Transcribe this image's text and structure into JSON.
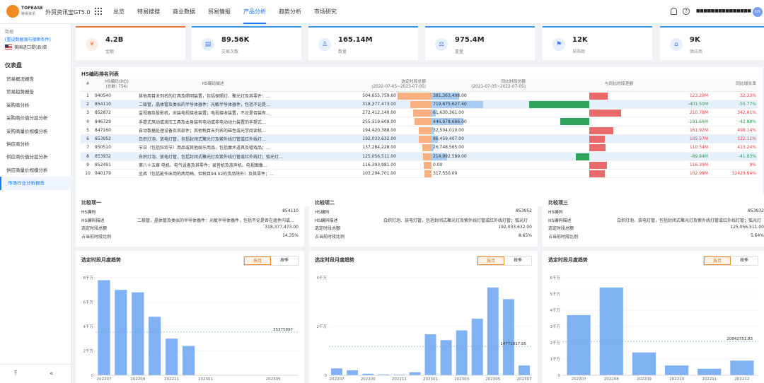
{
  "header": {
    "logo_main": "TOPEASE",
    "logo_sub": "特易资讯",
    "app_title": "外贸资讯宝GT5.0",
    "nav": [
      "总览",
      "特易搜搜",
      "商业数据",
      "贸易情报",
      "产品分析",
      "趋势分析",
      "市场研究"
    ],
    "nav_active": 4,
    "help_glyph": "?",
    "username": "■■■■■■■■■■■■■■■■■■■",
    "avatar_text": "CH"
  },
  "sidebar": {
    "source_label": "数据",
    "criteria_link": "[重设数据源与搜索条件]",
    "country": "美国进口提(品)单",
    "heading": "仪表盘",
    "items": [
      "贸易概况报告",
      "贸易趋势报告",
      "采购商分析",
      "采购商价值分层分析",
      "采购商量价规模分析",
      "供应商分析",
      "供应商价值分层分析",
      "供应商量价规模分析",
      "市场行业分析报告"
    ],
    "active": 8,
    "collapse_glyph": "⤒",
    "fold_glyph": "«"
  },
  "kpis": [
    {
      "value": "4.2B",
      "label": "金额",
      "icon": "¥",
      "color": "#f07a3a",
      "bg": "#fdeee6"
    },
    {
      "value": "89.56K",
      "label": "交易次数",
      "icon": "▤",
      "color": "#3a7af0",
      "bg": "#e6efff"
    },
    {
      "value": "165.14M",
      "label": "数量",
      "icon": "♙",
      "color": "#3a7af0",
      "bg": "#e6efff"
    },
    {
      "value": "975.4M",
      "label": "重量",
      "icon": "⚖",
      "color": "#3a7af0",
      "bg": "#e6efff"
    },
    {
      "value": "12K",
      "label": "采购商",
      "icon": "⚑",
      "color": "#3a7af0",
      "bg": "#e6efff"
    },
    {
      "value": "9K",
      "label": "供应商",
      "icon": "⌂",
      "color": "#3a7af0",
      "bg": "#e6efff"
    }
  ],
  "rank": {
    "title": "HS编码排名列表",
    "col_index": "#",
    "col_code": "HS编码(8位)",
    "col_code_total": "(总数: 754)",
    "col_desc": "HS编码描述",
    "col_cur": "选定时段总额",
    "col_cur_range": "(2022-07-05~2023-07-05)",
    "col_prev": "同比时段总额",
    "col_prev_range": "(2021-07-05~2022-07-05)",
    "col_diff": "与同比时段差额",
    "col_rate": "同比增长率",
    "rows": [
      {
        "i": "1",
        "code": "940540",
        "desc": "其他用目未列名的灯具及照明装置，包括探照灯、聚光灯及其零件：…",
        "cur": "504,655,759.60",
        "cur_v": 504.66,
        "prev": "381,363,408.00",
        "prev_v": 381.36,
        "diff": "123.29M",
        "diff_v": 123.29,
        "rate": "32.33%",
        "hl": false
      },
      {
        "i": "2",
        "code": "854110",
        "desc": "二极管，晶体管及类似的半导体器件：光敏半导体器件，包括不论是…",
        "cur": "318,377,473.00",
        "cur_v": 318.38,
        "prev": "719,875,627.40",
        "prev_v": 719.88,
        "diff": "-401.50M",
        "diff_v": -401.5,
        "rate": "-55.77%",
        "hl": true
      },
      {
        "i": "3",
        "code": "852872",
        "desc": "监视器及投影机，未装电视接收装置；电视接收装置，不论是否装有…",
        "cur": "272,412,140.00",
        "cur_v": 272.41,
        "prev": "61,630,361.00",
        "prev_v": 61.63,
        "diff": "210.78M",
        "diff_v": 210.78,
        "rate": "342.01%",
        "hl": false
      },
      {
        "i": "4",
        "code": "846729",
        "desc": "手提式风动或液压工具及本身装有电动或非电动动力装置的手提式…",
        "cur": "255,319,609.00",
        "cur_v": 255.32,
        "prev": "446,978,686.00",
        "prev_v": 446.98,
        "diff": "-191.66M",
        "diff_v": -191.66,
        "rate": "-42.88%",
        "hl": false
      },
      {
        "i": "5",
        "code": "847160",
        "desc": "自动数据处理设备及其部件；其他税目未列名的磁性或光学阅读机…",
        "cur": "194,420,388.00",
        "cur_v": 194.42,
        "prev": "32,504,010.00",
        "prev_v": 32.5,
        "diff": "161.92M",
        "diff_v": 161.92,
        "rate": "498.14%",
        "hl": false
      },
      {
        "i": "6",
        "code": "853952",
        "desc": "白炽灯泡、放电灯管，包括封闭式聚光灯及紫外线灯管或红外线灯…",
        "cur": "192,033,632.00",
        "cur_v": 192.03,
        "prev": "86,459,407.00",
        "prev_v": 86.46,
        "diff": "105.57M",
        "diff_v": 105.57,
        "rate": "122.11%",
        "hl": true
      },
      {
        "i": "7",
        "code": "950510",
        "desc": "节日（包括狂欢节）用品或其他娱乐用品，包括魔术道具及嘘戏品；…",
        "cur": "137,284,228.00",
        "cur_v": 137.28,
        "prev": "26,748,565.00",
        "prev_v": 26.75,
        "diff": "110.54M",
        "diff_v": 110.54,
        "rate": "413.24%",
        "hl": false
      },
      {
        "i": "8",
        "code": "853932",
        "desc": "白炽灯泡、放电灯管，包括封闭式聚光灯及紫外线灯管或红外线灯；弧光灯…",
        "cur": "125,056,511.00",
        "cur_v": 125.06,
        "prev": "214,992,589.00",
        "prev_v": 214.99,
        "diff": "-89.94M",
        "diff_v": -89.94,
        "rate": "-41.83%",
        "hl": true
      },
      {
        "i": "9",
        "code": "852491",
        "desc": "第八十五章 电机、电气设备及其零件；录音机及放声机、电视图像…",
        "cur": "116,393,981.00",
        "cur_v": 116.39,
        "prev": "0.00",
        "prev_v": 0,
        "diff": "116.39M",
        "diff_v": 116.39,
        "rate": "0%",
        "hl": false
      },
      {
        "i": "10",
        "code": "940179",
        "desc": "坐具（包括能作床用的两用椅，但税目94.02的货品除外）及其零件；…",
        "cur": "103,294,701.00",
        "cur_v": 103.29,
        "prev": "317,550.00",
        "prev_v": 0.32,
        "diff": "102.98M",
        "diff_v": 102.98,
        "rate": "32429.64%",
        "hl": false
      }
    ]
  },
  "compare": {
    "k_code": "HS编码",
    "k_desc": "HS编码描述",
    "k_total": "选定时段总额",
    "k_ratio": "占当前时段比例",
    "items": [
      {
        "title": "比较项一",
        "code": "854110",
        "desc": "二极管，晶体管及类似的半导体器件：光敏半导体器件，包括不论是否在组件内或…",
        "total": "318,377,473.00",
        "ratio": "14.35%"
      },
      {
        "title": "比较项二",
        "code": "853952",
        "desc": "白炽灯泡、放电灯管，包括封闭式聚光灯及紫外线灯管或红外线灯管；弧光灯",
        "total": "192,033,632.00",
        "ratio": "8.65%"
      },
      {
        "title": "比较项三",
        "code": "853932",
        "desc": "白炽灯泡、放电灯管，包括封闭式聚光灯及紫外线灯管或红外线灯管；弧光灯",
        "total": "125,056,511.00",
        "ratio": "5.64%"
      }
    ]
  },
  "charts_ui": {
    "title": "选定时段月度趋势",
    "tab_month": "按月",
    "tab_quarter": "按季"
  },
  "chart_data": [
    {
      "type": "bar",
      "title": "选定时段月度趋势",
      "y_ticks": [
        "0",
        "2千万",
        "4千万",
        "6千万",
        "8千万"
      ],
      "ylim": [
        0,
        80000000
      ],
      "categories": [
        "202207",
        "202208",
        "202209",
        "202210",
        "202211",
        "202212",
        "202301",
        "202302",
        "202303",
        "202304",
        "202305",
        "202306"
      ],
      "x_tick_labels": [
        "202207",
        "202209",
        "202211",
        "202301",
        "202305"
      ],
      "values": [
        78000000,
        70000000,
        68000000,
        48000000,
        30000000,
        24000000,
        0,
        0,
        0,
        0,
        0,
        0
      ],
      "avg_line": 35375897,
      "avg_label": "35375897"
    },
    {
      "type": "bar",
      "title": "选定时段月度趋势",
      "y_ticks": [
        "0",
        "2千万",
        "4千万"
      ],
      "ylim": [
        0,
        50000000
      ],
      "categories": [
        "202207",
        "202208",
        "202209",
        "202210",
        "202211",
        "202212",
        "202301",
        "202302",
        "202303",
        "202304",
        "202305",
        "202306",
        "202307"
      ],
      "x_tick_labels": [
        "202207",
        "202209",
        "202211",
        "202301",
        "202303",
        "202305",
        "202307"
      ],
      "values": [
        3500000,
        2500000,
        800000,
        400000,
        300000,
        1500000,
        21000000,
        18000000,
        23000000,
        29000000,
        45000000,
        39000000,
        5000000
      ],
      "avg_line": 14771817.85,
      "avg_label": "14771817.85"
    },
    {
      "type": "bar",
      "title": "选定时段月度趋势",
      "y_ticks": [
        "0",
        "1千万",
        "2千万",
        "3千万",
        "4千万",
        "5千万",
        "6千万"
      ],
      "ylim": [
        0,
        60000000
      ],
      "categories": [
        "202207",
        "202208",
        "202209",
        "202210",
        "202211",
        "202212"
      ],
      "x_tick_labels": [
        "202207",
        "202208",
        "202209",
        "202210",
        "202211",
        "202212"
      ],
      "values": [
        37000000,
        54000000,
        14000000,
        6000000,
        4000000,
        9000000
      ],
      "avg_line": 20842751.83,
      "avg_label": "20842751.83"
    }
  ]
}
